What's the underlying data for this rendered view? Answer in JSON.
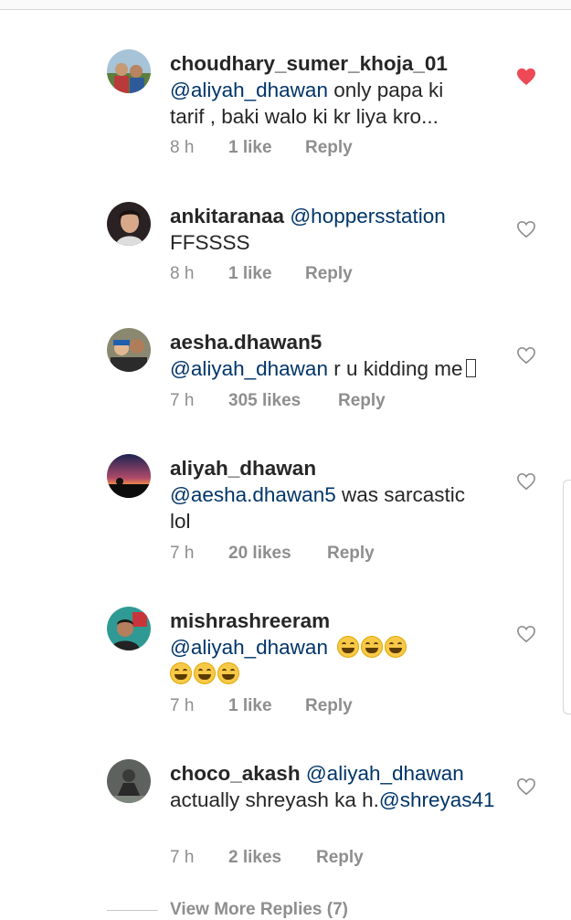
{
  "comments": [
    {
      "username": "choudhary_sumer_khoja_01",
      "mention": "@aliyah_dhawan",
      "text": " only papa ki tarif , baki walo ki kr liya kro...",
      "time": "8 h",
      "likes": "1 like",
      "reply": "Reply",
      "liked": true,
      "avatar_color": "#7a9a5a"
    },
    {
      "username": "ankitaranaa",
      "mention": "@hoppersstation",
      "text": "FFSSSS",
      "time": "8 h",
      "likes": "1 like",
      "reply": "Reply",
      "liked": false,
      "avatar_color": "#3a3030"
    },
    {
      "username": "aesha.dhawan5",
      "mention": "@aliyah_dhawan",
      "text": " r u kidding me",
      "time": "7 h",
      "likes": "305 likes",
      "reply": "Reply",
      "liked": false,
      "avatar_color": "#4a4a3a"
    },
    {
      "username": "aliyah_dhawan",
      "mention": "@aesha.dhawan5",
      "text": " was sarcastic lol",
      "time": "7 h",
      "likes": "20 likes",
      "reply": "Reply",
      "liked": false,
      "avatar_color": "#1e2a4a"
    },
    {
      "username": "mishrashreeram",
      "mention": "@aliyah_dhawan",
      "text": "",
      "time": "7 h",
      "likes": "1 like",
      "reply": "Reply",
      "liked": false,
      "avatar_color": "#2f8f8a"
    },
    {
      "username": "choco_akash",
      "mention": "@aliyah_dhawan",
      "text": "actually shreyash ka h.",
      "mention2": "@shreyas41",
      "time": "7 h",
      "likes": "2 likes",
      "reply": "Reply",
      "liked": false,
      "avatar_color": "#6a6a6a"
    }
  ],
  "view_more": "View More Replies (7)",
  "colors": {
    "liked_heart": "#ed4956",
    "meta_gray": "#8e8e8e",
    "mention_blue": "#003569"
  },
  "icons": [
    "heart-filled-icon",
    "heart-outline-icon"
  ]
}
